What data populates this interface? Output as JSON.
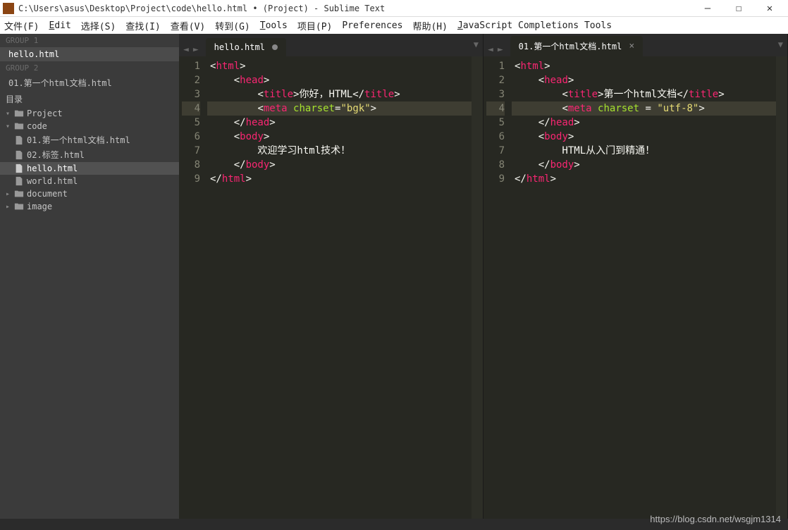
{
  "title": "C:\\Users\\asus\\Desktop\\Project\\code\\hello.html • (Project) - Sublime Text",
  "menus": {
    "file": "文件(F)",
    "edit": "Edit",
    "select": "选择(S)",
    "find": "查找(I)",
    "view": "查看(V)",
    "goto": "转到(G)",
    "tools": "Tools",
    "project": "项目(P)",
    "preferences": "Preferences",
    "help": "帮助(H)",
    "jscomp": "JavaScript Completions Tools"
  },
  "sidebar": {
    "group1": "GROUP 1",
    "group1_items": [
      "hello.html"
    ],
    "group2": "GROUP 2",
    "group2_items": [
      "01.第一个html文档.html"
    ],
    "dir_heading": "目录",
    "tree": {
      "project": "Project",
      "code": "code",
      "code_files": [
        "01.第一个html文档.html",
        "02.标签.html",
        "hello.html",
        "world.html"
      ],
      "document": "document",
      "image": "image"
    },
    "selected_file": "hello.html",
    "active_open": "hello.html"
  },
  "panes": [
    {
      "tab_label": "hello.html",
      "dirty": true,
      "highlighted_line": 4,
      "lines": [
        [
          [
            "p",
            "<"
          ],
          [
            "tag",
            "html"
          ],
          [
            "p",
            ">"
          ]
        ],
        [
          [
            "text",
            "    "
          ],
          [
            "p",
            "<"
          ],
          [
            "tag",
            "head"
          ],
          [
            "p",
            ">"
          ]
        ],
        [
          [
            "text",
            "        "
          ],
          [
            "p",
            "<"
          ],
          [
            "tag",
            "title"
          ],
          [
            "p",
            ">"
          ],
          [
            "text",
            "你好，HTML"
          ],
          [
            "p",
            "</"
          ],
          [
            "tag",
            "title"
          ],
          [
            "p",
            ">"
          ]
        ],
        [
          [
            "text",
            "        "
          ],
          [
            "p",
            "<"
          ],
          [
            "tag",
            "meta"
          ],
          [
            "text",
            " "
          ],
          [
            "attr",
            "charset"
          ],
          [
            "eq",
            "="
          ],
          [
            "str",
            "\"bgk\""
          ],
          [
            "p",
            ">"
          ]
        ],
        [
          [
            "text",
            "    "
          ],
          [
            "p",
            "</"
          ],
          [
            "tag",
            "head"
          ],
          [
            "p",
            ">"
          ]
        ],
        [
          [
            "text",
            "    "
          ],
          [
            "p",
            "<"
          ],
          [
            "tag",
            "body"
          ],
          [
            "p",
            ">"
          ]
        ],
        [
          [
            "text",
            "        欢迎学习html技术！"
          ]
        ],
        [
          [
            "text",
            "    "
          ],
          [
            "p",
            "</"
          ],
          [
            "tag",
            "body"
          ],
          [
            "p",
            ">"
          ]
        ],
        [
          [
            "p",
            "</"
          ],
          [
            "tag",
            "html"
          ],
          [
            "p",
            ">"
          ]
        ]
      ]
    },
    {
      "tab_label": "01.第一个html文档.html",
      "dirty": false,
      "highlighted_line": 4,
      "lines": [
        [
          [
            "p",
            "<"
          ],
          [
            "tag",
            "html"
          ],
          [
            "p",
            ">"
          ]
        ],
        [
          [
            "text",
            "    "
          ],
          [
            "p",
            "<"
          ],
          [
            "tag",
            "head"
          ],
          [
            "p",
            ">"
          ]
        ],
        [
          [
            "text",
            "        "
          ],
          [
            "p",
            "<"
          ],
          [
            "tag",
            "title"
          ],
          [
            "p",
            ">"
          ],
          [
            "text",
            "第一个html文档"
          ],
          [
            "p",
            "</"
          ],
          [
            "tag",
            "title"
          ],
          [
            "p",
            ">"
          ]
        ],
        [
          [
            "text",
            "        "
          ],
          [
            "p",
            "<"
          ],
          [
            "tag",
            "meta"
          ],
          [
            "text",
            " "
          ],
          [
            "attr",
            "charset"
          ],
          [
            "text",
            " "
          ],
          [
            "eq",
            "="
          ],
          [
            "text",
            " "
          ],
          [
            "str",
            "\"utf-8\""
          ],
          [
            "p",
            ">"
          ]
        ],
        [
          [
            "text",
            "    "
          ],
          [
            "p",
            "</"
          ],
          [
            "tag",
            "head"
          ],
          [
            "p",
            ">"
          ]
        ],
        [
          [
            "text",
            "    "
          ],
          [
            "p",
            "<"
          ],
          [
            "tag",
            "body"
          ],
          [
            "p",
            ">"
          ]
        ],
        [
          [
            "text",
            "        HTML从入门到精通！"
          ]
        ],
        [
          [
            "text",
            "    "
          ],
          [
            "p",
            "</"
          ],
          [
            "tag",
            "body"
          ],
          [
            "p",
            ">"
          ]
        ],
        [
          [
            "p",
            "</"
          ],
          [
            "tag",
            "html"
          ],
          [
            "p",
            ">"
          ]
        ]
      ]
    }
  ],
  "watermark": "https://blog.csdn.net/wsgjm1314"
}
